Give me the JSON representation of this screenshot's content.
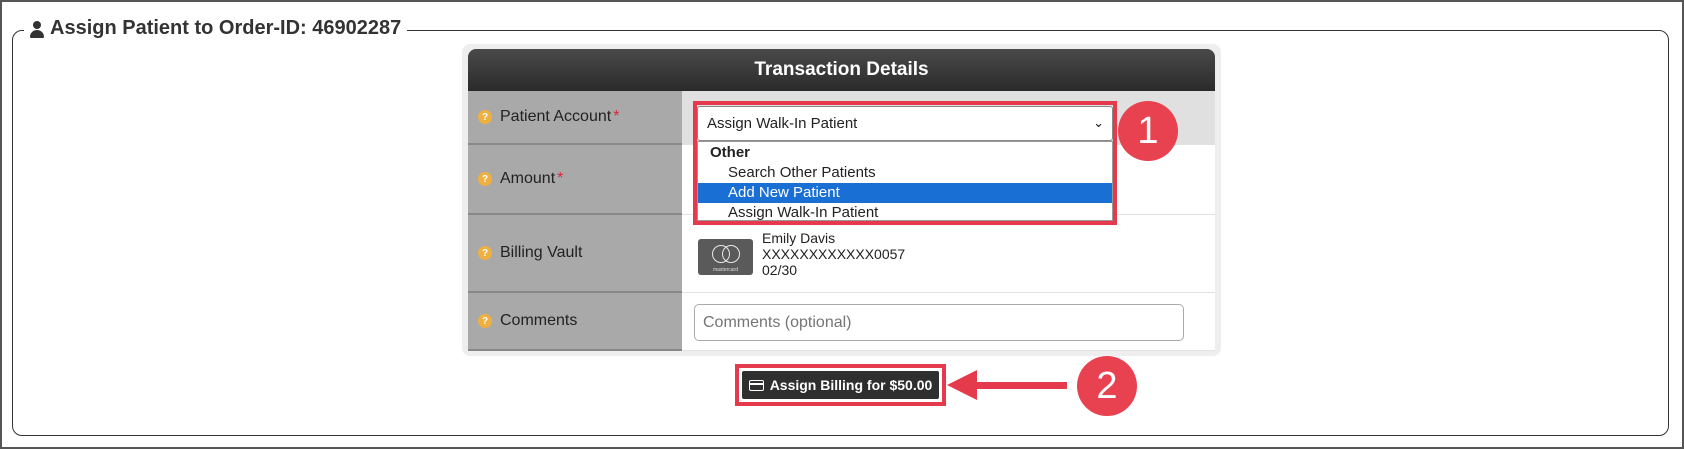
{
  "legend": {
    "title": "Assign Patient to Order-ID: 46902287",
    "icon": "user-icon"
  },
  "panel": {
    "header": "Transaction Details"
  },
  "rows": {
    "patient_account": {
      "label": "Patient Account",
      "required": "*"
    },
    "amount": {
      "label": "Amount",
      "required": "*"
    },
    "billing_vault": {
      "label": "Billing Vault"
    },
    "comments": {
      "label": "Comments"
    }
  },
  "patient_select": {
    "selected": "Assign Walk-In Patient",
    "group": "Other",
    "options": [
      "Search Other Patients",
      "Add New Patient",
      "Assign Walk-In Patient"
    ],
    "highlighted_option": "Add New Patient"
  },
  "billing_vault": {
    "card_brand": "mastercard",
    "name": "Emily Davis",
    "number": "XXXXXXXXXXXX0057",
    "expiry": "02/30"
  },
  "comments_input": {
    "placeholder": "Comments (optional)",
    "value": ""
  },
  "assign_button": {
    "label": "Assign Billing for $50.00",
    "icon": "credit-card-icon"
  },
  "annotations": {
    "badge_1": "1",
    "badge_2": "2"
  },
  "colors": {
    "highlight": "#e53a4c",
    "header_bg": "#333333",
    "label_bg": "#a9a9a9",
    "selected_option": "#1a6fd4",
    "help_icon": "#f0b040"
  }
}
